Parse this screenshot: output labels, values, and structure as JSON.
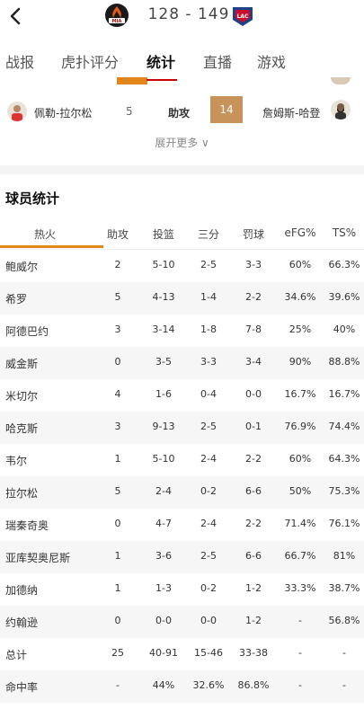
{
  "header": {
    "score": "128 - 149",
    "home_logo_text": "MIA",
    "away_logo_text": "LAC"
  },
  "tabs": [
    "战报",
    "虎扑评分",
    "统计",
    "直播",
    "游戏"
  ],
  "compare": {
    "left_player": "佩勒-拉尔松",
    "left_value": "5",
    "stat": "助攻",
    "right_value": "14",
    "right_player": "詹姆斯-哈登"
  },
  "more_label": "展开更多 ∨",
  "section_title": "球员统计",
  "table": {
    "columns": [
      "热火",
      "助攻",
      "投篮",
      "三分",
      "罚球",
      "eFG%",
      "TS%"
    ],
    "rows": [
      [
        "鲍威尔",
        "2",
        "5-10",
        "2-5",
        "3-3",
        "60%",
        "66.3%"
      ],
      [
        "希罗",
        "5",
        "4-13",
        "1-4",
        "2-2",
        "34.6%",
        "39.6%"
      ],
      [
        "阿德巴约",
        "3",
        "3-14",
        "1-8",
        "7-8",
        "25%",
        "40%"
      ],
      [
        "威金斯",
        "0",
        "3-5",
        "3-3",
        "3-4",
        "90%",
        "88.8%"
      ],
      [
        "米切尔",
        "4",
        "1-6",
        "0-4",
        "0-0",
        "16.7%",
        "16.7%"
      ],
      [
        "哈克斯",
        "3",
        "9-13",
        "2-5",
        "0-1",
        "76.9%",
        "74.4%"
      ],
      [
        "韦尔",
        "1",
        "5-10",
        "2-4",
        "2-2",
        "60%",
        "64.3%"
      ],
      [
        "拉尔松",
        "5",
        "2-4",
        "0-2",
        "6-6",
        "50%",
        "75.3%"
      ],
      [
        "瑞秦奇奥",
        "0",
        "4-7",
        "2-4",
        "2-2",
        "71.4%",
        "76.1%"
      ],
      [
        "亚库契奥尼斯",
        "1",
        "3-6",
        "2-5",
        "6-6",
        "66.7%",
        "81%"
      ],
      [
        "加德纳",
        "1",
        "1-3",
        "0-2",
        "1-2",
        "33.3%",
        "38.7%"
      ],
      [
        "约翰逊",
        "0",
        "0-0",
        "0-0",
        "1-2",
        "-",
        "56.8%"
      ],
      [
        "总计",
        "25",
        "40-91",
        "15-46",
        "33-38",
        "-",
        "-"
      ],
      [
        "命中率",
        "-",
        "44%",
        "32.6%",
        "86.8%",
        "-",
        "-"
      ]
    ]
  },
  "colors": {
    "accent": "#e2861c",
    "stat_box": "#c8935b"
  }
}
